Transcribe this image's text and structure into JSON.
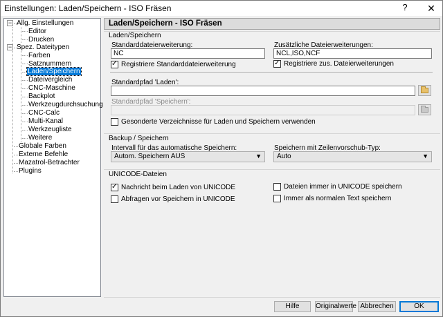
{
  "window": {
    "title": "Einstellungen: Laden/Speichern - ISO Fräsen",
    "help_glyph": "?",
    "close_glyph": "✕"
  },
  "tree": {
    "items": [
      {
        "label": "Allg. Einstellungen",
        "expander": "−"
      },
      {
        "label": "Editor"
      },
      {
        "label": "Drucken"
      },
      {
        "label": "Spez. Dateitypen",
        "expander": "−"
      },
      {
        "label": "Farben"
      },
      {
        "label": "Satznummern"
      },
      {
        "label": "Laden/Speichern",
        "selected": true
      },
      {
        "label": "Dateivergleich"
      },
      {
        "label": "CNC-Maschine"
      },
      {
        "label": "Backplot"
      },
      {
        "label": "Werkzeugdurchsuchung"
      },
      {
        "label": "CNC-Calc"
      },
      {
        "label": "Multi-Kanal"
      },
      {
        "label": "Werkzeugliste"
      },
      {
        "label": "Weitere"
      },
      {
        "label": "Globale Farben"
      },
      {
        "label": "Externe Befehle"
      },
      {
        "label": "Mazatrol-Betrachter"
      },
      {
        "label": "Plugins"
      }
    ]
  },
  "page": {
    "header": "Laden/Speichern - ISO Fräsen"
  },
  "load_save": {
    "group_title": "Laden/Speichern",
    "default_ext_label": "Standarddateierweiterung:",
    "default_ext_value": "NC",
    "register_default_label": "Registriere Standarddateierweiterung",
    "register_default_checked": true,
    "extra_ext_label": "Zusätzliche Dateierweiterungen:",
    "extra_ext_value": "NCL,ISO,NCF",
    "register_extra_label": "Registriere zus. Dateierweiterungen",
    "register_extra_checked": true,
    "load_path_label": "Standardpfad 'Laden':",
    "load_path_value": "",
    "save_path_label": "Standardpfad 'Speichern':",
    "save_path_value": "",
    "separate_dirs_label": "Gesonderte Verzeichnisse für Laden und Speichern verwenden",
    "separate_dirs_checked": false
  },
  "backup": {
    "group_title": "Backup / Speichern",
    "interval_label": "Intervall für das automatische Speichern:",
    "interval_value": "Autom. Speichern AUS",
    "linefeed_label": "Speichern mit Zeilenvorschub-Typ:",
    "linefeed_value": "Auto"
  },
  "unicode": {
    "group_title": "UNICODE-Dateien",
    "notify_load_label": "Nachricht beim Laden von UNICODE",
    "notify_load_checked": true,
    "ask_save_label": "Abfragen vor Speichern in UNICODE",
    "ask_save_checked": false,
    "always_unicode_label": "Dateien immer in UNICODE speichern",
    "always_unicode_checked": false,
    "always_text_label": "Immer als normalen Text speichern",
    "always_text_checked": false
  },
  "buttons": {
    "help": "Hilfe",
    "defaults": "Originalwerte",
    "cancel": "Abbrechen",
    "ok": "OK"
  },
  "icons": {
    "folder": "folder-icon",
    "dropdown": "▼"
  },
  "colors": {
    "selection": "#0078d7",
    "header_bg": "#dcdcdc",
    "window_bg": "#f0f0f0"
  }
}
